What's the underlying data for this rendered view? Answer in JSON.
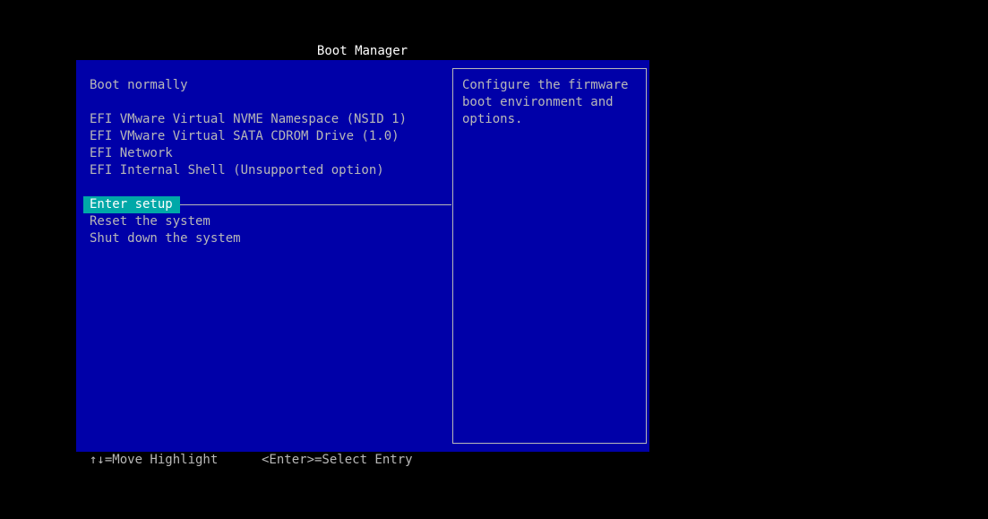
{
  "header": {
    "title": "Boot Manager"
  },
  "menu": {
    "boot_normally": "Boot normally",
    "devices": [
      "EFI VMware Virtual NVME Namespace (NSID 1)",
      "EFI VMware Virtual SATA CDROM Drive (1.0)",
      "EFI Network",
      "EFI Internal Shell (Unsupported option)"
    ],
    "actions": [
      "Enter setup",
      "Reset the system",
      "Shut down the system"
    ],
    "selected": "Enter setup"
  },
  "help": {
    "lines": [
      "Configure the firmware",
      "boot environment and",
      "options."
    ]
  },
  "footer": {
    "move_hint": "↑↓=Move Highlight",
    "select_hint": "<Enter>=Select Entry"
  },
  "colors": {
    "background": "#000000",
    "panel": "#0000a8",
    "text": "#b8b8b8",
    "highlight": "#00a8a8",
    "highlight_text": "#ffffff",
    "title": "#ffffff"
  }
}
